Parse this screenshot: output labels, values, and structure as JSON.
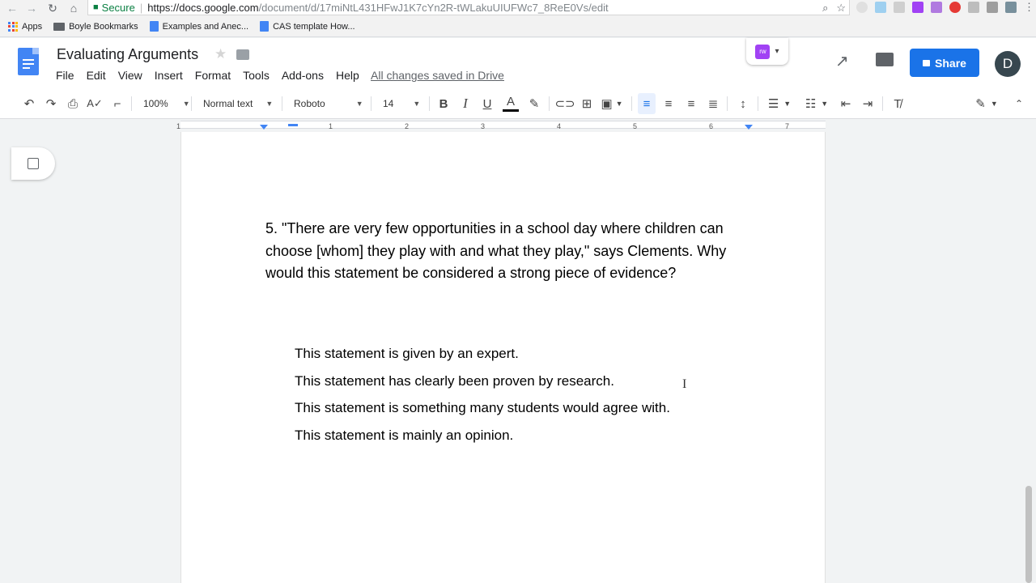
{
  "browser": {
    "secure_label": "Secure",
    "url_host": "https://docs.google.com",
    "url_path": "/document/d/17miNtL431HFwJ1K7cYn2R-tWLakuUIUFWc7_8ReE0Vs/edit"
  },
  "bookmarks": [
    {
      "label": "Apps",
      "icon": "apps-grid-icon"
    },
    {
      "label": "Boyle Bookmarks",
      "icon": "folder-icon"
    },
    {
      "label": "Examples and Anec...",
      "icon": "doc-icon"
    },
    {
      "label": "CAS template How...",
      "icon": "doc-icon"
    }
  ],
  "header": {
    "title": "Evaluating Arguments",
    "menu": [
      "File",
      "Edit",
      "View",
      "Insert",
      "Format",
      "Tools",
      "Add-ons",
      "Help"
    ],
    "save_status": "All changes saved in Drive",
    "share_label": "Share",
    "avatar_initial": "D",
    "addon_badge": "rw"
  },
  "toolbar": {
    "zoom": "100%",
    "style": "Normal text",
    "font": "Roboto",
    "font_size": "14",
    "bold": "B",
    "italic": "I",
    "underline": "U",
    "text_color": "A"
  },
  "ruler": {
    "numbers": [
      "1",
      "1",
      "2",
      "3",
      "4",
      "5",
      "6",
      "7"
    ]
  },
  "document": {
    "question": "5. \"There are very few opportunities in a school day where children can choose [whom] they play with and what they play,\" says Clements. Why would this statement be considered a strong piece of evidence?",
    "answers": [
      "This statement is given by an expert.",
      "This statement has clearly been proven by research.",
      "This statement is something many students would agree with.",
      "This statement is mainly an opinion."
    ]
  },
  "colors": {
    "accent": "#1a73e8",
    "docs_blue": "#4285f4",
    "secure_green": "#0b8043",
    "addon_purple": "#a142f4"
  }
}
